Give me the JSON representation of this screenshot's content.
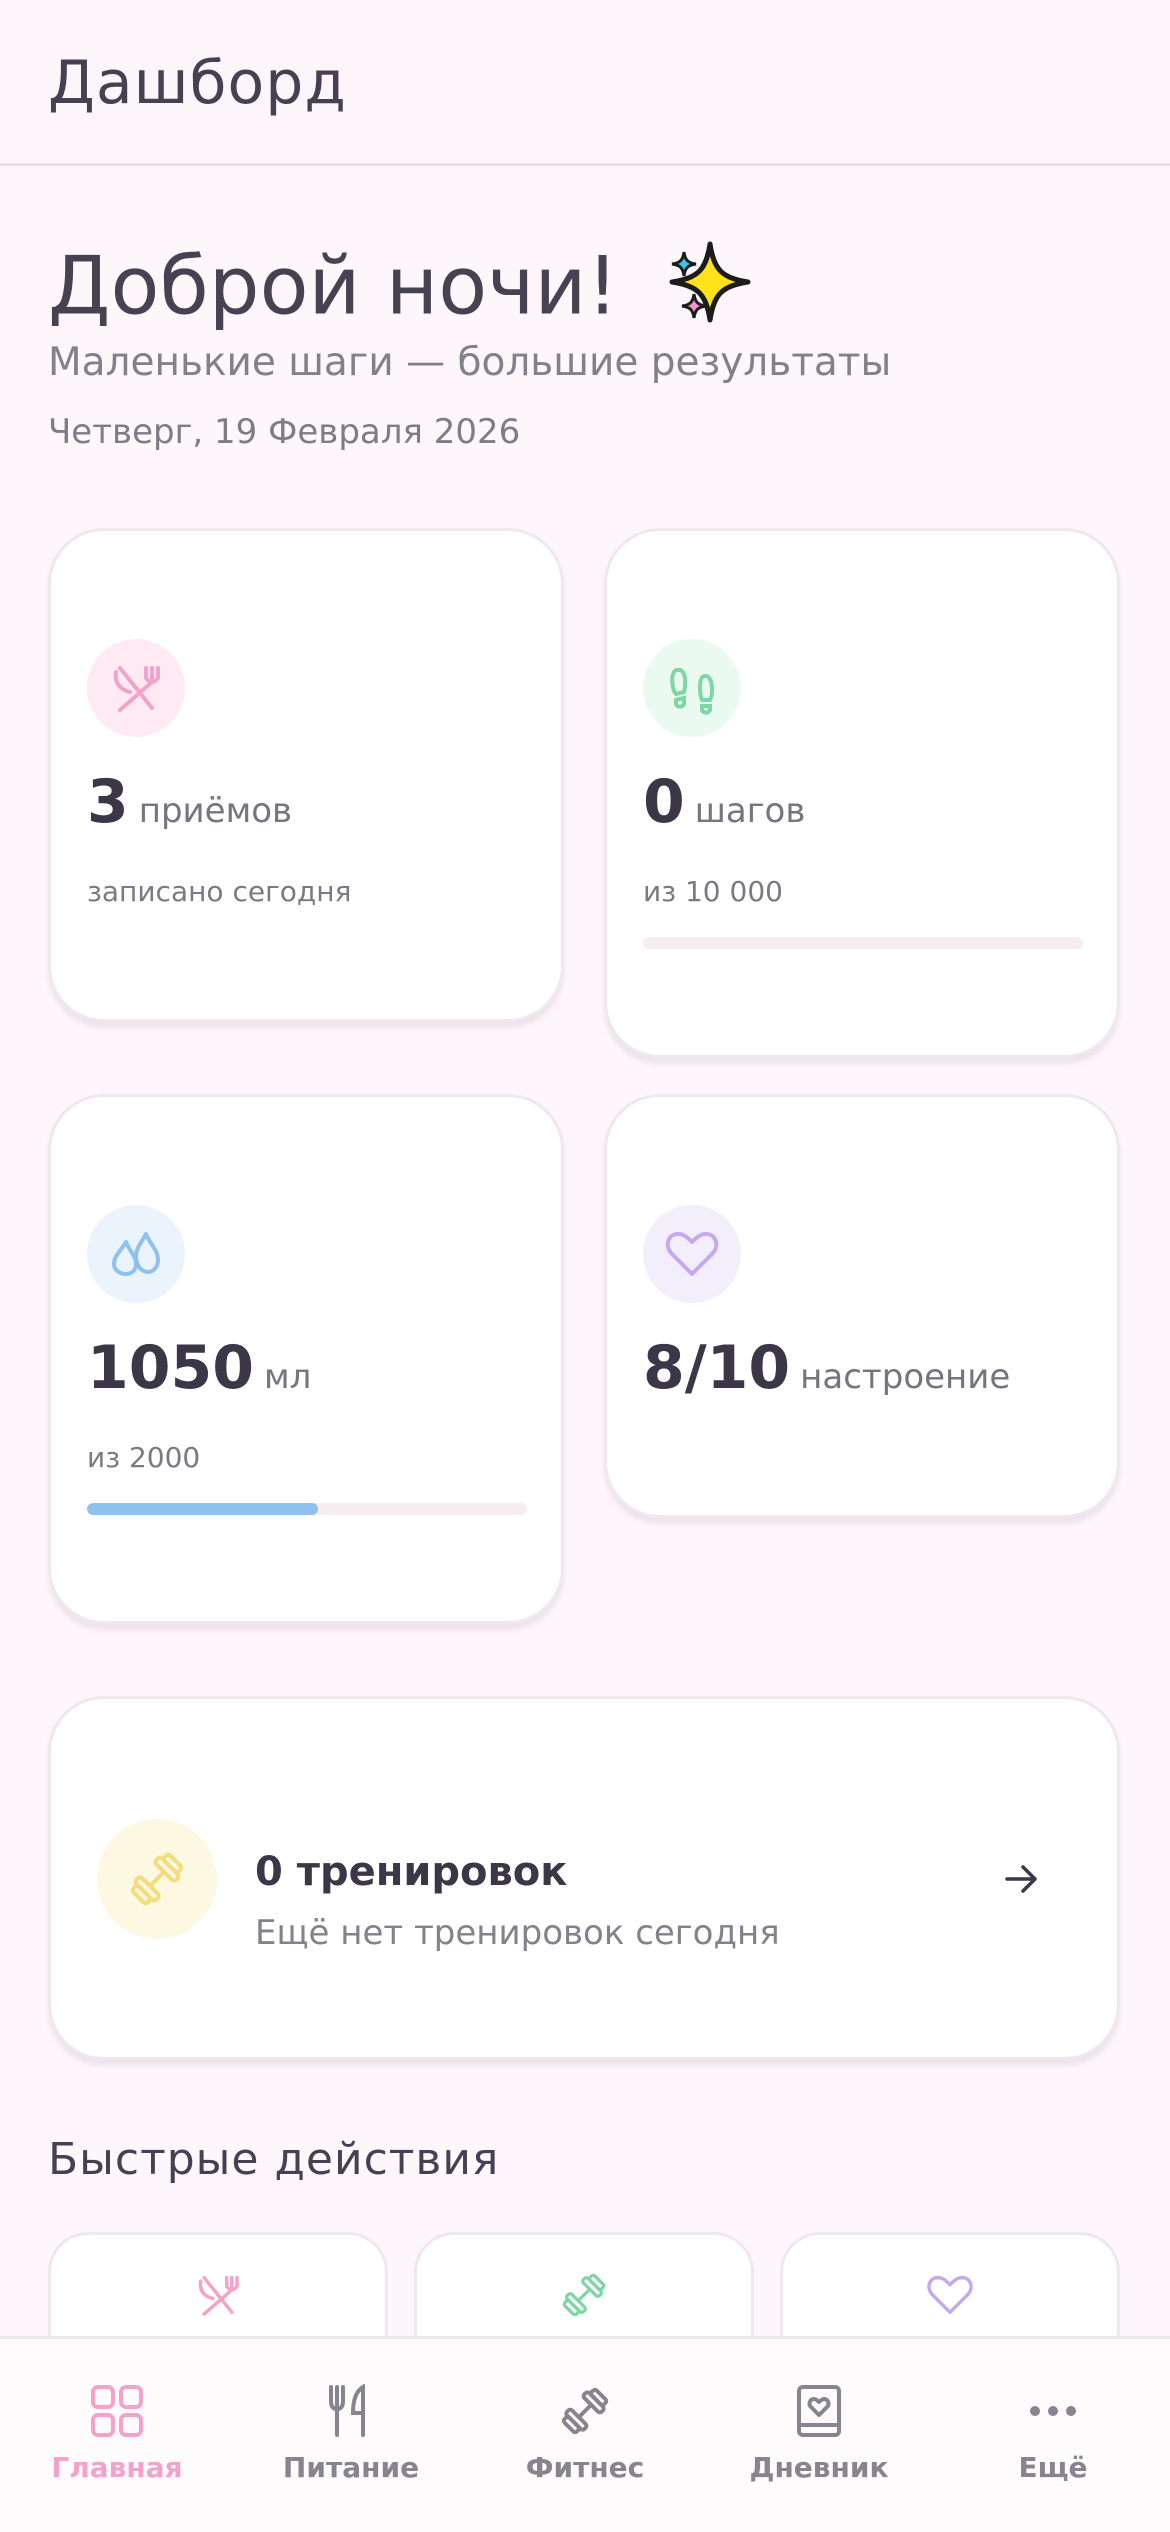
{
  "header": {
    "title": "Дашборд"
  },
  "greeting": {
    "title": "Доброй ночи!",
    "subtitle": "Маленькие шаги — большие результаты",
    "date": "Четверг, 19 Февраля 2026"
  },
  "stats": {
    "meals": {
      "value": "3",
      "unit": "приёмов",
      "sub": "записано сегодня",
      "icon": "fork-knife-crossed-icon",
      "color": "#f3a3c8"
    },
    "steps": {
      "value": "0",
      "unit": "шагов",
      "sub": "из 10 000",
      "progress": 0,
      "icon": "footprints-icon",
      "color": "#7fd6a5"
    },
    "water": {
      "value": "1050",
      "unit": "мл",
      "sub": "из 2000",
      "progress": 0.525,
      "icon": "droplets-icon",
      "color": "#8fc1ee"
    },
    "mood": {
      "value": "8/10",
      "unit": "настроение",
      "icon": "heart-icon",
      "color": "#c4a9ef"
    }
  },
  "workouts": {
    "title": "0 тренировок",
    "subtitle": "Ещё нет тренировок сегодня",
    "icon": "dumbbell-icon",
    "color": "#f4dc7c"
  },
  "quick_actions": {
    "title": "Быстрые действия",
    "items": [
      {
        "icon": "fork-knife-crossed-icon",
        "color": "#f3a3c8"
      },
      {
        "icon": "dumbbell-icon",
        "color": "#7fd6a5"
      },
      {
        "icon": "heart-icon",
        "color": "#c4a9ef"
      }
    ]
  },
  "tabbar": {
    "items": [
      {
        "label": "Главная",
        "icon": "grid-icon",
        "active": true
      },
      {
        "label": "Питание",
        "icon": "utensils-icon",
        "active": false
      },
      {
        "label": "Фитнес",
        "icon": "dumbbell-icon",
        "active": false
      },
      {
        "label": "Дневник",
        "icon": "journal-icon",
        "active": false
      },
      {
        "label": "Ещё",
        "icon": "more-icon",
        "active": false
      }
    ],
    "active_color": "#f2a2cc",
    "inactive_color": "#87838f"
  }
}
